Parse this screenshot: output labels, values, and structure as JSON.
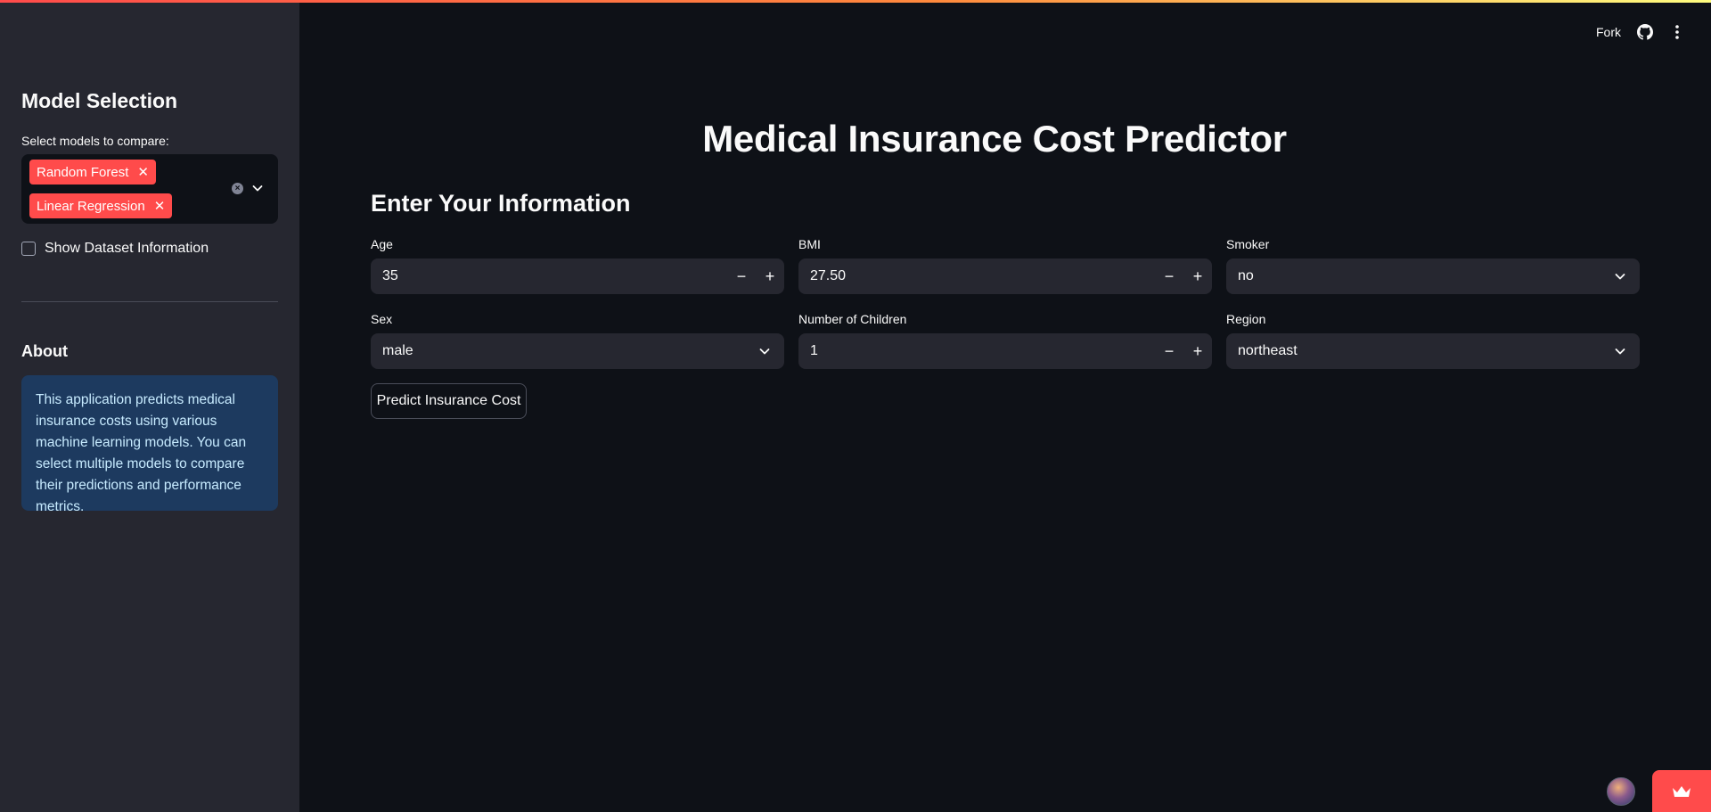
{
  "sidebar": {
    "title": "Model Selection",
    "select_label": "Select models to compare:",
    "selected_models": [
      "Random Forest",
      "Linear Regression"
    ],
    "show_dataset_label": "Show Dataset Information",
    "show_dataset_checked": false,
    "about_title": "About",
    "about_text": "This application predicts medical insurance costs using various machine learning models. You can select multiple models to compare their predictions and performance metrics."
  },
  "header": {
    "fork_label": "Fork",
    "github_icon": "github-icon",
    "menu_icon": "more-vertical-icon"
  },
  "main": {
    "title": "Medical Insurance Cost Predictor",
    "subtitle": "Enter Your Information",
    "fields": {
      "age": {
        "label": "Age",
        "value": "35"
      },
      "bmi": {
        "label": "BMI",
        "value": "27.50"
      },
      "smoker": {
        "label": "Smoker",
        "value": "no"
      },
      "sex": {
        "label": "Sex",
        "value": "male"
      },
      "children": {
        "label": "Number of Children",
        "value": "1"
      },
      "region": {
        "label": "Region",
        "value": "northeast"
      }
    },
    "predict_button": "Predict Insurance Cost"
  },
  "colors": {
    "accent": "#ff4b4b",
    "background": "#0e1117",
    "sidebar": "#262730",
    "info_box": "#1d3a5f"
  }
}
